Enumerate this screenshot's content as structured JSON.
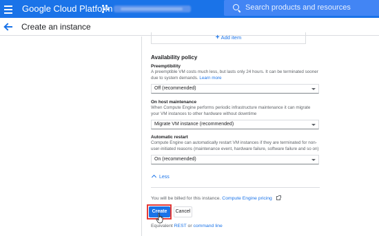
{
  "topbar": {
    "app_title": "Google Cloud Platform",
    "search_placeholder": "Search products and resources",
    "color": "#1a73e8"
  },
  "header": {
    "title": "Create an instance"
  },
  "add_item": {
    "label": "Add item"
  },
  "availability": {
    "title": "Availability policy",
    "preemptibility": {
      "label": "Preemptibility",
      "description": "A preemptible VM costs much less, but lasts only 24 hours. It can be terminated sooner due to system demands.",
      "learn_more": "Learn more",
      "selected": "Off (recommended)"
    },
    "host_maintenance": {
      "label": "On host maintenance",
      "description": "When Compute Engine performs periodic infrastructure maintenance it can migrate your VM instances to other hardware without downtime",
      "selected": "Migrate VM instance (recommended)"
    },
    "automatic_restart": {
      "label": "Automatic restart",
      "description": "Compute Engine can automatically restart VM instances if they are terminated for non-user-initiated reasons (maintenance event, hardware failure, software failure and so on)",
      "selected": "On (recommended)"
    }
  },
  "less_label": "Less",
  "billing": {
    "text": "You will be billed for this instance.",
    "link": "Compute Engine pricing"
  },
  "actions": {
    "create": "Create",
    "cancel": "Cancel"
  },
  "equivalent": {
    "prefix": "Equivalent",
    "rest": "REST",
    "or": "or",
    "command_line": "command line"
  },
  "highlight_color": "#e53935"
}
